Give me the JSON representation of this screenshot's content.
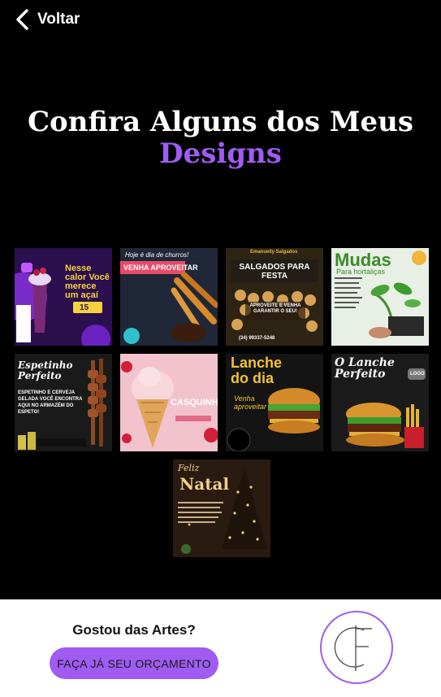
{
  "header": {
    "back_label": "Voltar"
  },
  "title": {
    "line1": "Confira Alguns dos Meus",
    "line2": "Designs"
  },
  "portfolio": {
    "t1": {
      "headline": "Nesse calor Você merece um açaí",
      "price": "15"
    },
    "t2": {
      "script": "Hoje é dia de churros!",
      "headline": "VENHA APROVEITAR"
    },
    "t3": {
      "brand": "Emanuelly Salgados",
      "headline": "SALGADOS PARA FESTA",
      "sub": "APROVEITE E VENHA GARANTIR O SEU!",
      "phone": "(34) 99337-5248"
    },
    "t4": {
      "headline": "Mudas",
      "sub": "Para hortaliças"
    },
    "t5": {
      "headline": "Espetinho Perfeito",
      "sub": "ESPETINHO E CERVEJA GELADA VOCÊ ENCONTRA AQUI NO ARMAZÉM DO ESPETO!"
    },
    "t6": {
      "headline": "CASQUINHA"
    },
    "t7": {
      "headline": "Lanche do dia",
      "sub": "Venha aproveitar"
    },
    "t8": {
      "headline": "O Lanche Perfeito",
      "badge": "LOGO"
    },
    "t9": {
      "script": "Feliz",
      "headline": "Natal"
    }
  },
  "footer": {
    "question": "Gostou das Artes?",
    "cta_label": "FAÇA JÁ SEU ORÇAMENTO"
  },
  "colors": {
    "accent": "#a05cf2",
    "background": "#000000",
    "footer_bg": "#ffffff"
  }
}
